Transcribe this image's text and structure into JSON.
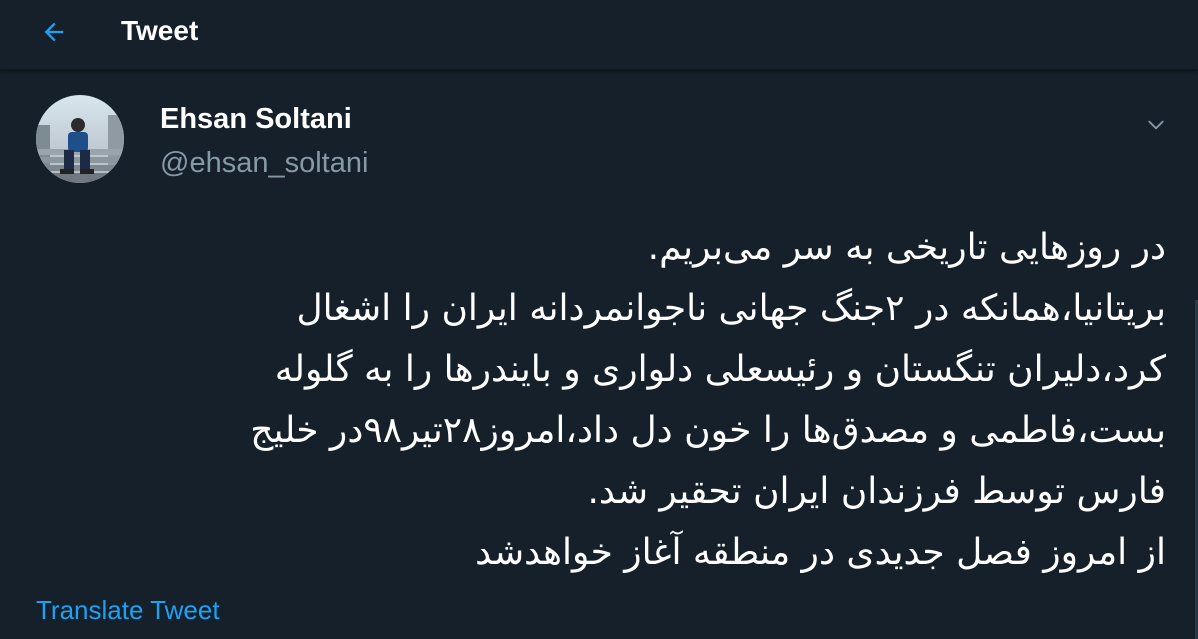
{
  "header": {
    "back_icon": "arrow-left-icon",
    "title": "Tweet"
  },
  "tweet": {
    "author_name": "Ehsan Soltani",
    "author_handle": "@ehsan_soltani",
    "menu_icon": "chevron-down-icon",
    "lines": [
      "در روزهایی تاریخی به سر می‌بریم.",
      "بریتانیا،همانکه در ۲جنگ جهانی ناجوانمردانه ایران را اشغال",
      "کرد،دلیران تنگستان و رئیسعلی دلواری و بایندرها را به گلوله",
      "بست،فاطمی و مصدق‌ها را خون دل داد،امروز۲۸تیر۹۸در خلیج",
      "فارس توسط فرزندان ایران تحقیر شد.",
      "از امروز فصل جدیدی در منطقه آغاز خواهدشد"
    ],
    "translate_label": "Translate Tweet"
  },
  "colors": {
    "background": "#15202b",
    "accent": "#1da1f2",
    "secondary_text": "#8899a6",
    "primary_text": "#ffffff"
  }
}
